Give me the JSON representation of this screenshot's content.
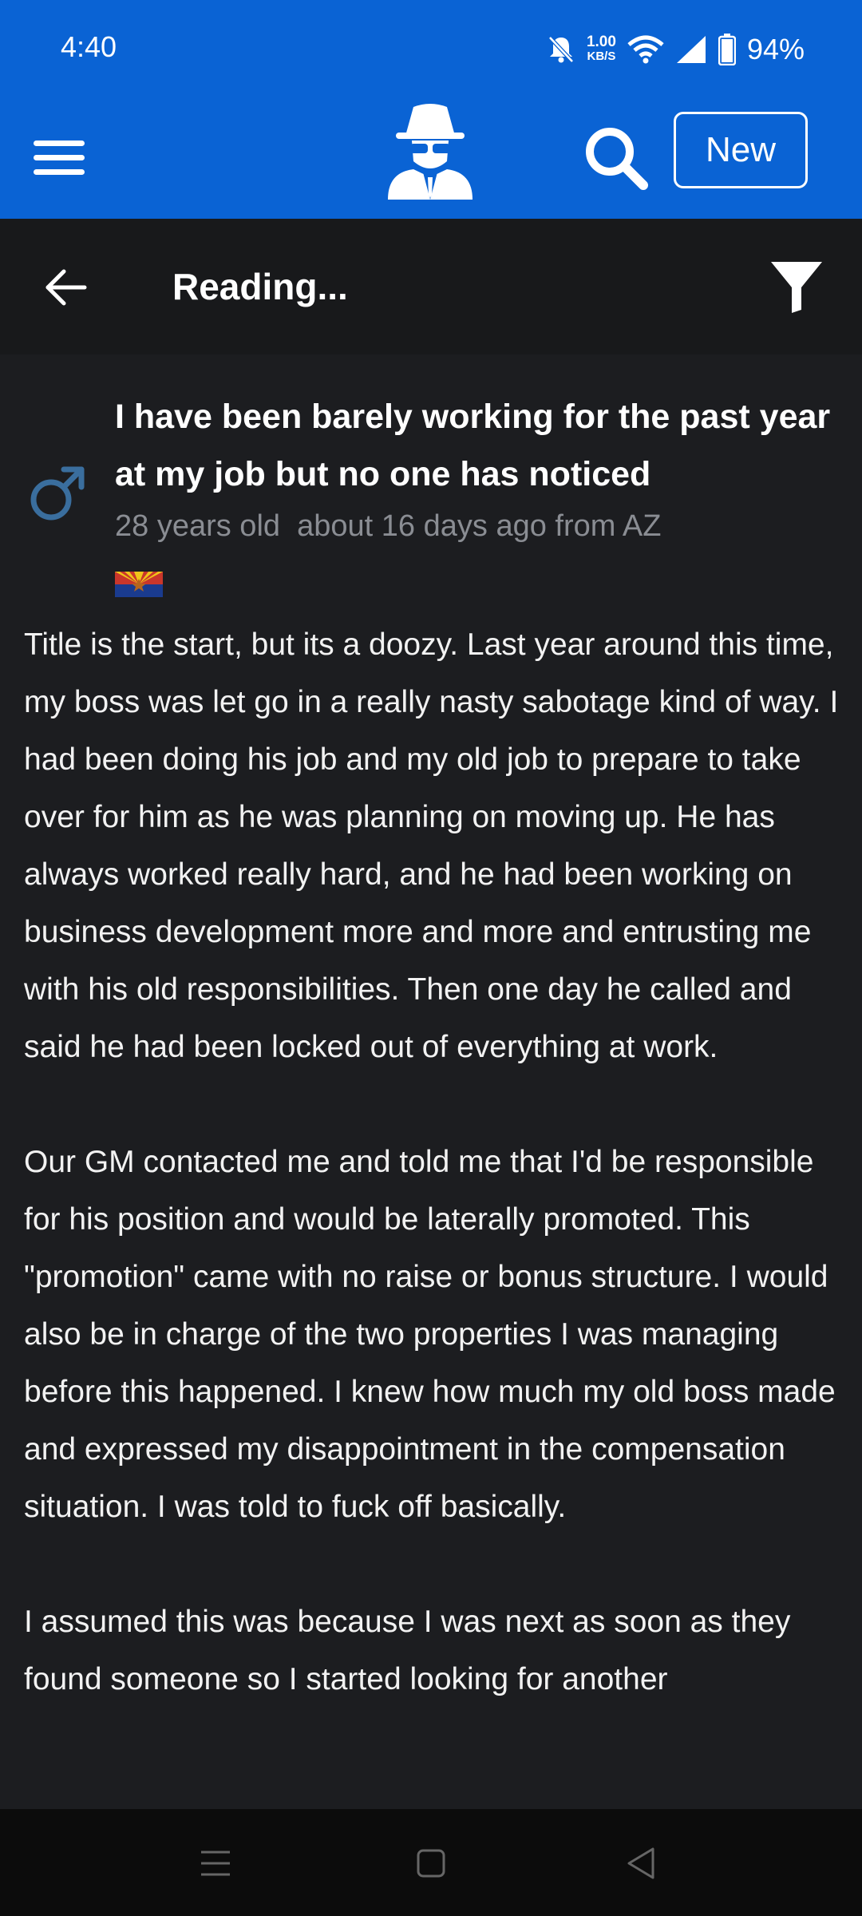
{
  "status_bar": {
    "time": "4:40",
    "net_speed_value": "1.00",
    "net_speed_unit": "KB/S",
    "battery": "94%",
    "icons": [
      "mute-bell-icon",
      "wifi-icon",
      "signal-icon",
      "battery-icon"
    ]
  },
  "app_bar": {
    "new_label": "New",
    "icons": [
      "menu-icon",
      "spy-logo-icon",
      "search-icon"
    ],
    "accent_color": "#0a63d4"
  },
  "sub_bar": {
    "title": "Reading...",
    "icons": [
      "back-arrow-icon",
      "filter-icon"
    ]
  },
  "post": {
    "title": "I have been barely working for the past year at my job but no one has noticed",
    "age": "28 years old",
    "time_ago": "about 16 days ago from AZ",
    "gender_icon": "male-symbol-icon",
    "flag": "arizona-flag-icon",
    "paragraphs": [
      "Title is the start, but its a doozy. Last year around this time, my boss was let go in a really nasty sabotage kind of way. I had been doing his job and my old job to prepare to take over for him as he was planning on moving up. He has always worked really hard, and he had been working on business development more and more and entrusting me with his old responsibilities. Then one day he called and said he had been locked out of everything at work.",
      "Our GM contacted me and told me that I'd be responsible for his position and would be laterally promoted. This \"promotion\" came with no raise or bonus structure. I would also be in charge of the two properties I was managing before this happened. I knew how much my old boss made and expressed my disappointment in the compensation situation. I was told to fuck off basically.",
      "I assumed this was because I was next as soon as they found someone so I started looking for another"
    ]
  },
  "nav_bar": {
    "icons": [
      "recents-icon",
      "home-icon",
      "back-triangle-icon"
    ]
  }
}
